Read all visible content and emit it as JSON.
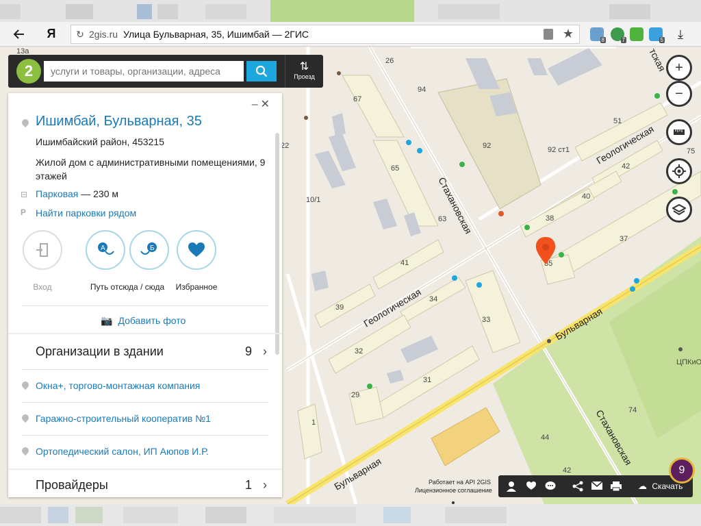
{
  "browser": {
    "yandex_logo": "Я",
    "domain": "2gis.ru",
    "page_title": "Улица Бульварная, 35, Ишимбай — 2ГИС",
    "ext_badges": [
      "8",
      "7",
      "",
      "5"
    ]
  },
  "search": {
    "logo": "2",
    "placeholder": "услуги и товары, организации, адреса",
    "route_label": "Проезд"
  },
  "card": {
    "title": "Ишимбай, Бульварная, 35",
    "district": "Ишимбайский район, 453215",
    "description": "Жилой дом с административными помещениями, 9 этажей",
    "stop_name": "Парковая",
    "stop_distance": " — 230 м",
    "parking_link": "Найти парковки рядом",
    "actions": [
      {
        "label": "Вход"
      },
      {
        "label": "Путь отсюда / сюда"
      },
      {
        "label": "Избранное"
      }
    ],
    "add_photo": "Добавить фото",
    "orgs_section": {
      "title": "Организации в здании",
      "count": "9"
    },
    "orgs": [
      "Окна+, торгово-монтажная компания",
      "Гаражно-строительный кооператив №1",
      "Ортопедический салон, ИП Аюпов И.Р."
    ],
    "providers_section": {
      "title": "Провайдеры",
      "count": "1"
    }
  },
  "map": {
    "streets": {
      "geologicheskaya_1": "Геологическая",
      "geologicheskaya_2": "Геологическая",
      "bulvarnaya_1": "Бульварная",
      "bulvarnaya_2": "Бульварная",
      "stakhanovskaya_1": "Стахановская",
      "stakhanovskaya_2": "Стахановская",
      "tskaya": "тская"
    },
    "houses": [
      "13a",
      "26",
      "94",
      "67",
      "92",
      "51",
      "75",
      "22",
      "65",
      "92 ст1",
      "42",
      "10/1",
      "40",
      "63",
      "38",
      "37",
      "41",
      "34",
      "39",
      "33",
      "32",
      "31",
      "29",
      "1",
      "74",
      "44",
      "42",
      "35"
    ],
    "poi_label": "ЦПКиО"
  },
  "toolbar": {
    "download": "Скачать",
    "works_on": "Работает на API 2GIS",
    "license": "Лицензионное соглашение"
  },
  "badge": {
    "count": "9"
  }
}
